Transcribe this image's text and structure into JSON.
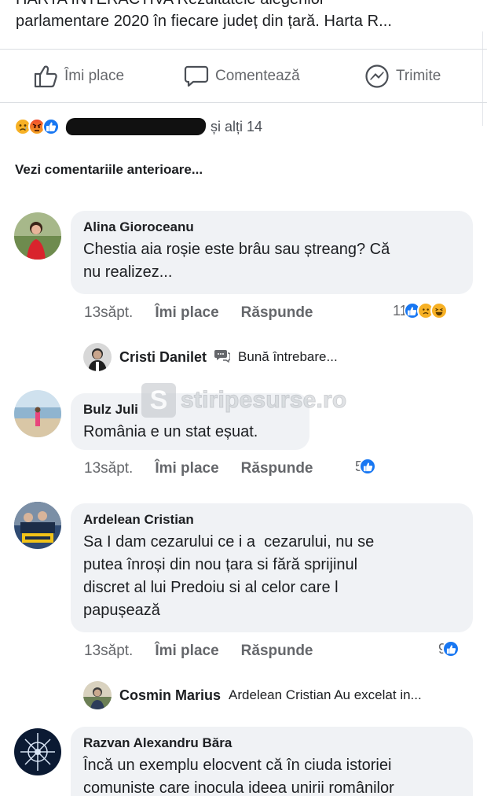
{
  "post": {
    "title_cut": "HARTA INTERACTIVA Rezultatele alegerilor",
    "title_line2": "parlamentare 2020 în fiecare județ din țară. Harta R..."
  },
  "actions": {
    "like": "Îmi place",
    "comment": "Comentează",
    "share": "Trimite"
  },
  "reactions_summary": {
    "icons": [
      "sad-icon",
      "angry-icon",
      "like-icon"
    ],
    "others_text": "și alți 14"
  },
  "view_previous": "Vezi comentariile anterioare...",
  "watermark": {
    "badge": "S",
    "text": "stiripesurse.ro"
  },
  "comments": [
    {
      "author": "Alina Gioroceanu",
      "text_lines": [
        "Chestia aia roșie este brâu sau ștreang? Că",
        "nu realizez..."
      ],
      "time": "13săpt.",
      "like_label": "Îmi place",
      "reply_label": "Răspunde",
      "reaction_count": "11",
      "reaction_icons": [
        "like-icon",
        "sad-icon",
        "laugh-icon"
      ],
      "reply": {
        "author": "Cristi Danilet",
        "text": "Bună întrebare..."
      }
    },
    {
      "author": "Bulz Juli",
      "text_lines": [
        "România e un stat eșuat."
      ],
      "time": "13săpt.",
      "like_label": "Îmi place",
      "reply_label": "Răspunde",
      "reaction_count": "5",
      "reaction_icons": [
        "like-icon"
      ]
    },
    {
      "author": "Ardelean Cristian",
      "text_lines": [
        "Sa I dam cezarului ce i a  cezarului, nu se",
        "putea înroși din nou țara si fără sprijinul",
        "discret al lui Predoiu si al celor care l",
        "papușează"
      ],
      "time": "13săpt.",
      "like_label": "Îmi place",
      "reply_label": "Răspunde",
      "reaction_count": "9",
      "reaction_icons": [
        "like-icon"
      ],
      "reply": {
        "author": "Cosmin Marius",
        "text": "Ardelean Cristian Au excelat in..."
      }
    },
    {
      "author": "Razvan Alexandru Băra",
      "text_lines": [
        "Încă un exemplu elocvent că în ciuda istoriei",
        "comuniste care inocula ideea unirii românilor"
      ]
    }
  ]
}
